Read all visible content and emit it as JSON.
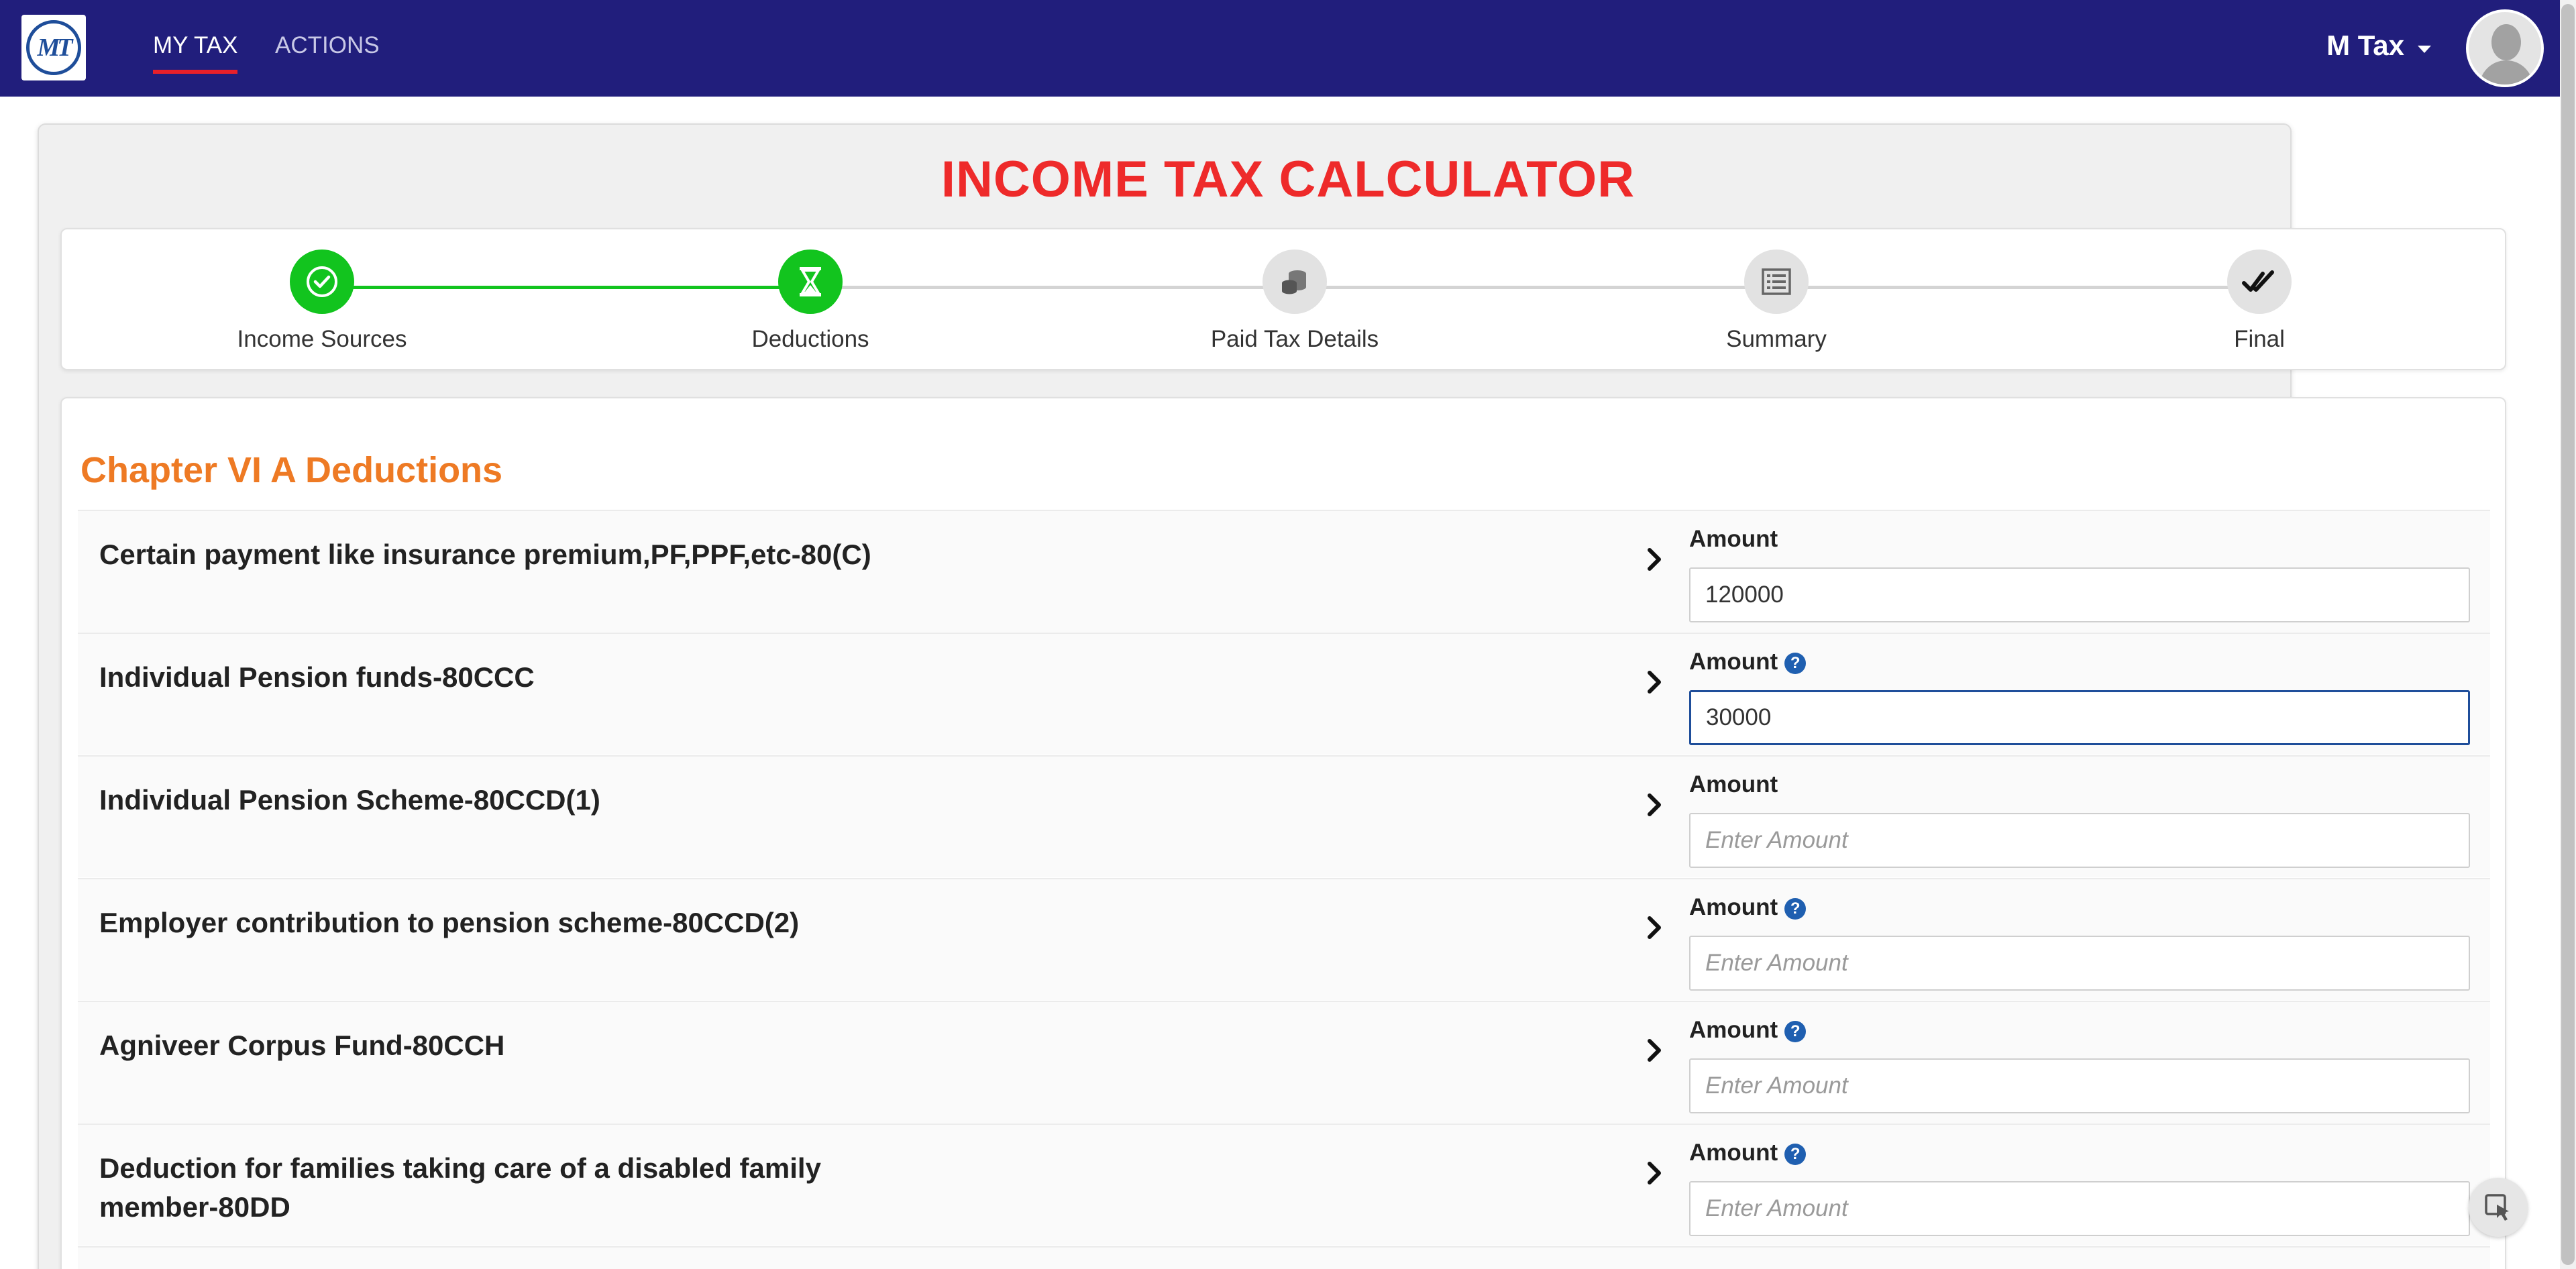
{
  "app": {
    "logo_text": "MT",
    "nav": [
      {
        "label": "MY TAX",
        "active": true
      },
      {
        "label": "ACTIONS",
        "active": false
      }
    ],
    "user_name": "M Tax"
  },
  "page": {
    "title": "INCOME TAX CALCULATOR"
  },
  "stepper": {
    "steps": [
      {
        "label": "Income Sources",
        "status": "completed",
        "icon": "check-circle-icon"
      },
      {
        "label": "Deductions",
        "status": "current",
        "icon": "hourglass-icon"
      },
      {
        "label": "Paid Tax Details",
        "status": "pending",
        "icon": "coins-icon"
      },
      {
        "label": "Summary",
        "status": "pending",
        "icon": "list-icon"
      },
      {
        "label": "Final",
        "status": "pending",
        "icon": "double-check-icon"
      }
    ],
    "colors": {
      "completed": "#12c41e",
      "pending": "#e2e2e2"
    }
  },
  "section": {
    "title": "Chapter VI A Deductions",
    "rows": [
      {
        "label": "Certain payment like insurance premium,PF,PPF,etc-80(C)",
        "amount_label": "Amount",
        "help": false,
        "value": "120000",
        "placeholder": "Enter Amount"
      },
      {
        "label": "Individual Pension funds-80CCC",
        "amount_label": "Amount",
        "help": true,
        "value": "30000",
        "placeholder": "Enter Amount"
      },
      {
        "label": "Individual Pension Scheme-80CCD(1)",
        "amount_label": "Amount",
        "help": false,
        "value": "",
        "placeholder": "Enter Amount"
      },
      {
        "label": "Employer contribution to pension scheme-80CCD(2)",
        "amount_label": "Amount",
        "help": true,
        "value": "",
        "placeholder": "Enter Amount"
      },
      {
        "label": "Agniveer Corpus Fund-80CCH",
        "amount_label": "Amount",
        "help": true,
        "value": "",
        "placeholder": "Enter Amount"
      },
      {
        "label": "Deduction for families taking care of a disabled family member-80DD",
        "amount_label": "Amount",
        "help": true,
        "value": "",
        "placeholder": "Enter Amount"
      }
    ]
  },
  "colors": {
    "navbar": "#211e7c",
    "title": "#ee2a2a",
    "section_title": "#ee7a24",
    "accent_green": "#12c41e",
    "nav_underline": "#e8202a"
  }
}
